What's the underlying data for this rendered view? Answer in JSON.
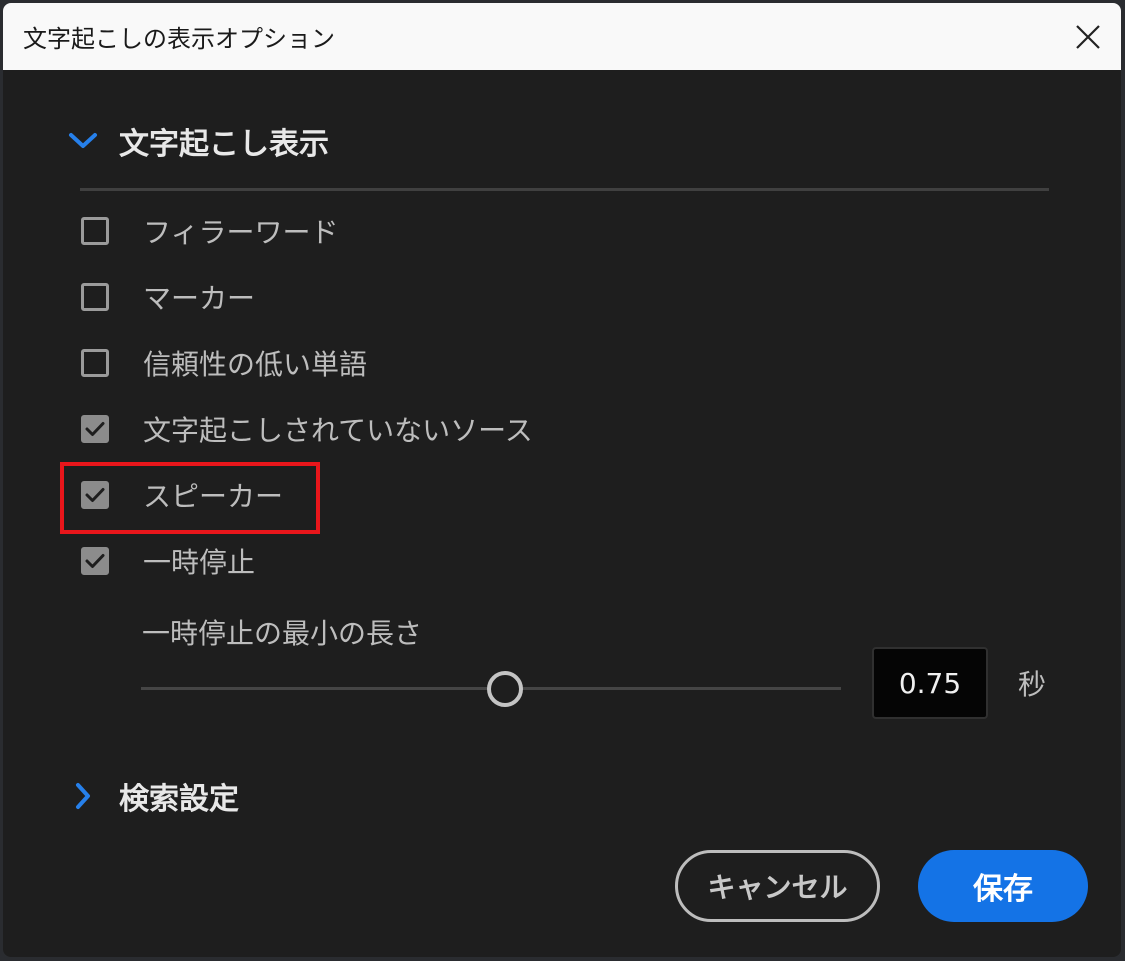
{
  "window": {
    "title": "文字起こしの表示オプション",
    "close_icon": "close-icon"
  },
  "sections": {
    "display": {
      "label": "文字起こし表示",
      "expanded": true,
      "accent_color": "#1473e6"
    },
    "search": {
      "label": "検索設定",
      "expanded": false
    }
  },
  "options": [
    {
      "label": "フィラーワード",
      "checked": false
    },
    {
      "label": "マーカー",
      "checked": false
    },
    {
      "label": "信頼性の低い単語",
      "checked": false
    },
    {
      "label": "文字起こしされていないソース",
      "checked": true
    },
    {
      "label": "スピーカー",
      "checked": true,
      "highlighted": true
    },
    {
      "label": "一時停止",
      "checked": true
    }
  ],
  "pause_min_length": {
    "label": "一時停止の最小の長さ",
    "value": "0.75",
    "unit": "秒"
  },
  "buttons": {
    "cancel": "キャンセル",
    "save": "保存"
  },
  "colors": {
    "highlight_border": "#e8161b",
    "primary_button": "#1473e6"
  }
}
